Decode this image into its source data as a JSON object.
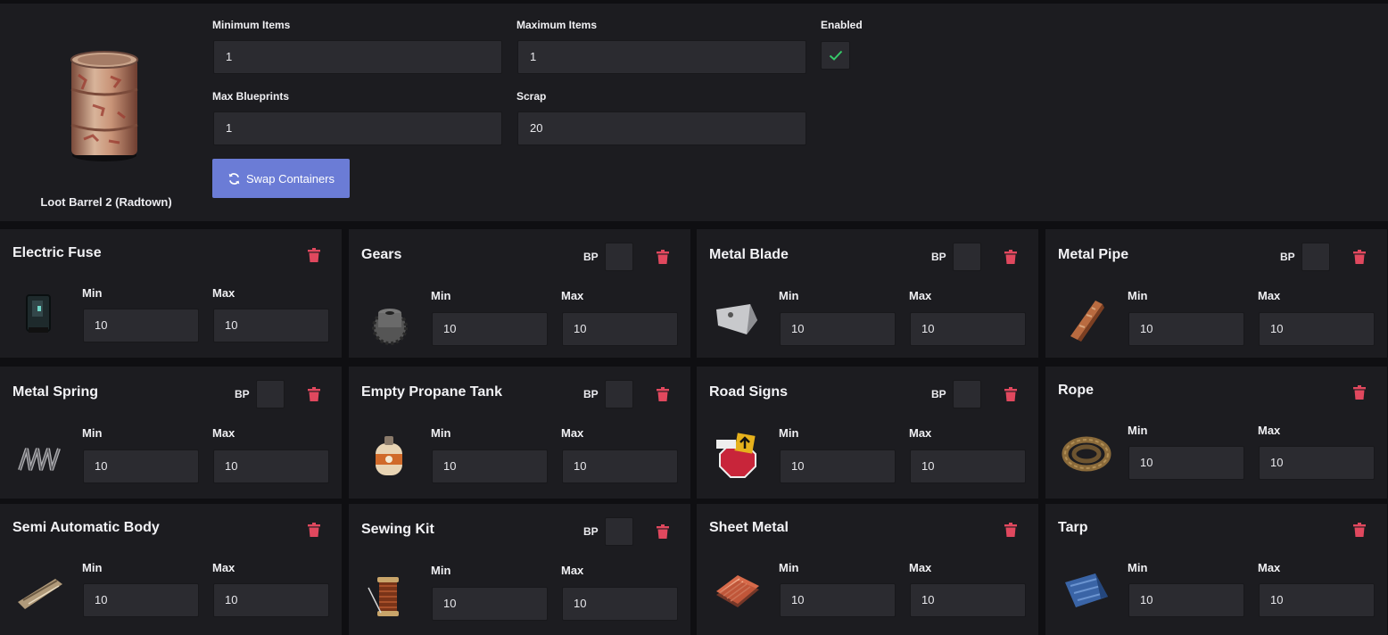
{
  "container": {
    "name": "Loot Barrel 2 (Radtown)",
    "image_icon": "loot-barrel-image",
    "min_items_label": "Minimum Items",
    "min_items": "1",
    "max_items_label": "Maximum Items",
    "max_items": "1",
    "enabled_label": "Enabled",
    "enabled": true,
    "max_blueprints_label": "Max Blueprints",
    "max_blueprints": "1",
    "scrap_label": "Scrap",
    "scrap": "20",
    "swap_label": "Swap Containers"
  },
  "labels": {
    "bp": "BP",
    "min": "Min",
    "max": "Max"
  },
  "colors": {
    "accent": "#6b7cd6",
    "danger": "#e0485e",
    "check": "#37c96a",
    "panel": "#1c1c20",
    "input": "#2b2b30"
  },
  "items": [
    {
      "name": "Electric Fuse",
      "icon": "electric-fuse-icon",
      "bp": false,
      "min": "10",
      "max": "10"
    },
    {
      "name": "Gears",
      "icon": "gears-icon",
      "bp": true,
      "min": "10",
      "max": "10"
    },
    {
      "name": "Metal Blade",
      "icon": "metal-blade-icon",
      "bp": true,
      "min": "10",
      "max": "10"
    },
    {
      "name": "Metal Pipe",
      "icon": "metal-pipe-icon",
      "bp": true,
      "min": "10",
      "max": "10"
    },
    {
      "name": "Metal Spring",
      "icon": "metal-spring-icon",
      "bp": true,
      "min": "10",
      "max": "10"
    },
    {
      "name": "Empty Propane Tank",
      "icon": "propane-tank-icon",
      "bp": true,
      "min": "10",
      "max": "10"
    },
    {
      "name": "Road Signs",
      "icon": "road-signs-icon",
      "bp": true,
      "min": "10",
      "max": "10"
    },
    {
      "name": "Rope",
      "icon": "rope-icon",
      "bp": false,
      "min": "10",
      "max": "10"
    },
    {
      "name": "Semi Automatic Body",
      "icon": "semi-auto-body-icon",
      "bp": false,
      "min": "10",
      "max": "10"
    },
    {
      "name": "Sewing Kit",
      "icon": "sewing-kit-icon",
      "bp": true,
      "min": "10",
      "max": "10"
    },
    {
      "name": "Sheet Metal",
      "icon": "sheet-metal-icon",
      "bp": false,
      "min": "10",
      "max": "10"
    },
    {
      "name": "Tarp",
      "icon": "tarp-icon",
      "bp": false,
      "min": "10",
      "max": "10"
    }
  ]
}
